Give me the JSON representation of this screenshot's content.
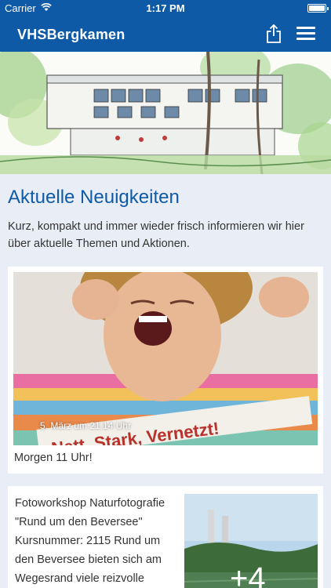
{
  "status_bar": {
    "carrier": "Carrier",
    "time": "1:17 PM"
  },
  "nav": {
    "title": "VHSBergkamen",
    "share_icon": "share-icon",
    "menu_icon": "hamburger-menu-icon"
  },
  "main": {
    "heading": "Aktuelle Neuigkeiten",
    "intro": "Kurz, kompakt und immer wieder frisch informieren wir hier über aktuelle Themen und Aktionen."
  },
  "news": [
    {
      "image_text": "Nett, Stark, Vernetzt!",
      "date": "5. März um 21:14 Uhr",
      "caption": "Morgen 11 Uhr!"
    },
    {
      "text": "Fotoworkshop Naturfotografie \"Rund um den Beversee\" Kursnummer: 2115 Rund um den Beversee bieten sich am Wegesrand viele reizvolle",
      "more_count": "+4"
    }
  ],
  "colors": {
    "brand": "#0e5aa7",
    "background": "#e9eef6"
  }
}
